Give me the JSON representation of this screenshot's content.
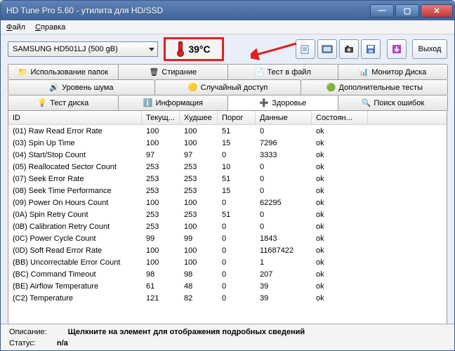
{
  "window": {
    "title": "HD Tune Pro 5.60 - утилита для HD/SSD"
  },
  "menu": {
    "file": "Файл",
    "help": "Справка"
  },
  "drive": {
    "selected": "SAMSUNG HD501LJ (500 gB)"
  },
  "temp": {
    "value": "39°C"
  },
  "buttons": {
    "exit": "Выход"
  },
  "tabs_row1": {
    "folder_usage": "Использование папок",
    "erase": "Стирание",
    "file_test": "Тест в файл",
    "disk_monitor": "Монитор Диска"
  },
  "tabs_row2": {
    "noise": "Уровень шума",
    "random": "Случайный доступ",
    "extra": "Дополнительные тесты"
  },
  "tabs_row3": {
    "bench": "Тест диска",
    "info": "Информация",
    "health": "Здоровье",
    "errors": "Поиск ошибок"
  },
  "columns": {
    "id": "ID",
    "current": "Текущ...",
    "worst": "Худшее",
    "threshold": "Порог",
    "data": "Данные",
    "status": "Состоян..."
  },
  "rows": [
    {
      "id": "(01) Raw Read Error Rate",
      "cur": "100",
      "worst": "100",
      "thr": "51",
      "data": "0",
      "st": "ok"
    },
    {
      "id": "(03) Spin Up Time",
      "cur": "100",
      "worst": "100",
      "thr": "15",
      "data": "7296",
      "st": "ok"
    },
    {
      "id": "(04) Start/Stop Count",
      "cur": "97",
      "worst": "97",
      "thr": "0",
      "data": "3333",
      "st": "ok"
    },
    {
      "id": "(05) Reallocated Sector Count",
      "cur": "253",
      "worst": "253",
      "thr": "10",
      "data": "0",
      "st": "ok"
    },
    {
      "id": "(07) Seek Error Rate",
      "cur": "253",
      "worst": "253",
      "thr": "51",
      "data": "0",
      "st": "ok"
    },
    {
      "id": "(08) Seek Time Performance",
      "cur": "253",
      "worst": "253",
      "thr": "15",
      "data": "0",
      "st": "ok"
    },
    {
      "id": "(09) Power On Hours Count",
      "cur": "100",
      "worst": "100",
      "thr": "0",
      "data": "62295",
      "st": "ok"
    },
    {
      "id": "(0A) Spin Retry Count",
      "cur": "253",
      "worst": "253",
      "thr": "51",
      "data": "0",
      "st": "ok"
    },
    {
      "id": "(0B) Calibration Retry Count",
      "cur": "253",
      "worst": "100",
      "thr": "0",
      "data": "0",
      "st": "ok"
    },
    {
      "id": "(0C) Power Cycle Count",
      "cur": "99",
      "worst": "99",
      "thr": "0",
      "data": "1843",
      "st": "ok"
    },
    {
      "id": "(0D) Soft Read Error Rate",
      "cur": "100",
      "worst": "100",
      "thr": "0",
      "data": "11687422",
      "st": "ok"
    },
    {
      "id": "(BB) Uncorrectable Error Count",
      "cur": "100",
      "worst": "100",
      "thr": "0",
      "data": "1",
      "st": "ok"
    },
    {
      "id": "(BC) Command Timeout",
      "cur": "98",
      "worst": "98",
      "thr": "0",
      "data": "207",
      "st": "ok"
    },
    {
      "id": "(BE) Airflow Temperature",
      "cur": "61",
      "worst": "48",
      "thr": "0",
      "data": "39",
      "st": "ok"
    },
    {
      "id": "(C2) Temperature",
      "cur": "121",
      "worst": "82",
      "thr": "0",
      "data": "39",
      "st": "ok"
    }
  ],
  "footer": {
    "desc_label": "Описание:",
    "desc_value": "Щелкните на элемент для отображения подробных сведений",
    "status_label": "Статус:",
    "status_value": "n/a"
  }
}
